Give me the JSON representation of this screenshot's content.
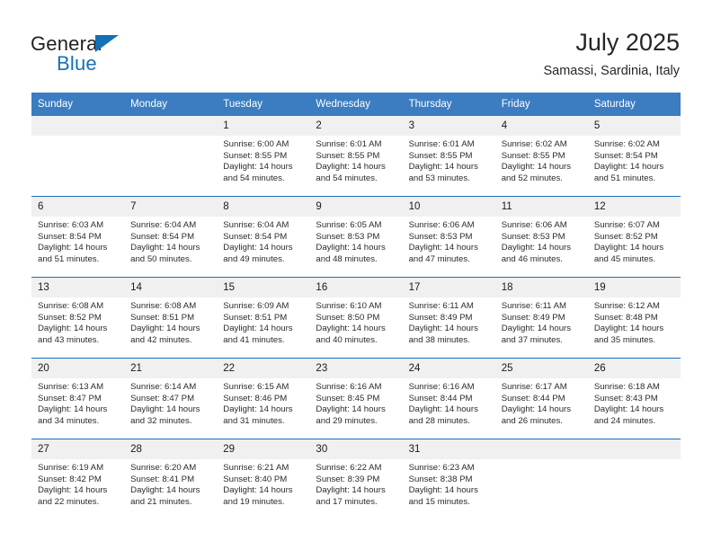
{
  "brand": {
    "name_top": "General",
    "name_bottom": "Blue",
    "triangle_color": "#1470b8"
  },
  "header": {
    "title": "July 2025",
    "subtitle": "Samassi, Sardinia, Italy"
  },
  "theme": {
    "header_bg": "#3b7dc0",
    "header_text": "#ffffff",
    "row_divider": "#1f6eb4",
    "daynum_bg": "#f0f0f0",
    "body_text": "#2b2b2b"
  },
  "weekday_headers": [
    "Sunday",
    "Monday",
    "Tuesday",
    "Wednesday",
    "Thursday",
    "Friday",
    "Saturday"
  ],
  "labels": {
    "sunrise": "Sunrise:",
    "sunset": "Sunset:",
    "daylight": "Daylight:"
  },
  "weeks": [
    [
      {
        "day": "",
        "empty": true
      },
      {
        "day": "",
        "empty": true
      },
      {
        "day": "1",
        "sunrise": "Sunrise: 6:00 AM",
        "sunset": "Sunset: 8:55 PM",
        "daylight_1": "Daylight: 14 hours",
        "daylight_2": "and 54 minutes."
      },
      {
        "day": "2",
        "sunrise": "Sunrise: 6:01 AM",
        "sunset": "Sunset: 8:55 PM",
        "daylight_1": "Daylight: 14 hours",
        "daylight_2": "and 54 minutes."
      },
      {
        "day": "3",
        "sunrise": "Sunrise: 6:01 AM",
        "sunset": "Sunset: 8:55 PM",
        "daylight_1": "Daylight: 14 hours",
        "daylight_2": "and 53 minutes."
      },
      {
        "day": "4",
        "sunrise": "Sunrise: 6:02 AM",
        "sunset": "Sunset: 8:55 PM",
        "daylight_1": "Daylight: 14 hours",
        "daylight_2": "and 52 minutes."
      },
      {
        "day": "5",
        "sunrise": "Sunrise: 6:02 AM",
        "sunset": "Sunset: 8:54 PM",
        "daylight_1": "Daylight: 14 hours",
        "daylight_2": "and 51 minutes."
      }
    ],
    [
      {
        "day": "6",
        "sunrise": "Sunrise: 6:03 AM",
        "sunset": "Sunset: 8:54 PM",
        "daylight_1": "Daylight: 14 hours",
        "daylight_2": "and 51 minutes."
      },
      {
        "day": "7",
        "sunrise": "Sunrise: 6:04 AM",
        "sunset": "Sunset: 8:54 PM",
        "daylight_1": "Daylight: 14 hours",
        "daylight_2": "and 50 minutes."
      },
      {
        "day": "8",
        "sunrise": "Sunrise: 6:04 AM",
        "sunset": "Sunset: 8:54 PM",
        "daylight_1": "Daylight: 14 hours",
        "daylight_2": "and 49 minutes."
      },
      {
        "day": "9",
        "sunrise": "Sunrise: 6:05 AM",
        "sunset": "Sunset: 8:53 PM",
        "daylight_1": "Daylight: 14 hours",
        "daylight_2": "and 48 minutes."
      },
      {
        "day": "10",
        "sunrise": "Sunrise: 6:06 AM",
        "sunset": "Sunset: 8:53 PM",
        "daylight_1": "Daylight: 14 hours",
        "daylight_2": "and 47 minutes."
      },
      {
        "day": "11",
        "sunrise": "Sunrise: 6:06 AM",
        "sunset": "Sunset: 8:53 PM",
        "daylight_1": "Daylight: 14 hours",
        "daylight_2": "and 46 minutes."
      },
      {
        "day": "12",
        "sunrise": "Sunrise: 6:07 AM",
        "sunset": "Sunset: 8:52 PM",
        "daylight_1": "Daylight: 14 hours",
        "daylight_2": "and 45 minutes."
      }
    ],
    [
      {
        "day": "13",
        "sunrise": "Sunrise: 6:08 AM",
        "sunset": "Sunset: 8:52 PM",
        "daylight_1": "Daylight: 14 hours",
        "daylight_2": "and 43 minutes."
      },
      {
        "day": "14",
        "sunrise": "Sunrise: 6:08 AM",
        "sunset": "Sunset: 8:51 PM",
        "daylight_1": "Daylight: 14 hours",
        "daylight_2": "and 42 minutes."
      },
      {
        "day": "15",
        "sunrise": "Sunrise: 6:09 AM",
        "sunset": "Sunset: 8:51 PM",
        "daylight_1": "Daylight: 14 hours",
        "daylight_2": "and 41 minutes."
      },
      {
        "day": "16",
        "sunrise": "Sunrise: 6:10 AM",
        "sunset": "Sunset: 8:50 PM",
        "daylight_1": "Daylight: 14 hours",
        "daylight_2": "and 40 minutes."
      },
      {
        "day": "17",
        "sunrise": "Sunrise: 6:11 AM",
        "sunset": "Sunset: 8:49 PM",
        "daylight_1": "Daylight: 14 hours",
        "daylight_2": "and 38 minutes."
      },
      {
        "day": "18",
        "sunrise": "Sunrise: 6:11 AM",
        "sunset": "Sunset: 8:49 PM",
        "daylight_1": "Daylight: 14 hours",
        "daylight_2": "and 37 minutes."
      },
      {
        "day": "19",
        "sunrise": "Sunrise: 6:12 AM",
        "sunset": "Sunset: 8:48 PM",
        "daylight_1": "Daylight: 14 hours",
        "daylight_2": "and 35 minutes."
      }
    ],
    [
      {
        "day": "20",
        "sunrise": "Sunrise: 6:13 AM",
        "sunset": "Sunset: 8:47 PM",
        "daylight_1": "Daylight: 14 hours",
        "daylight_2": "and 34 minutes."
      },
      {
        "day": "21",
        "sunrise": "Sunrise: 6:14 AM",
        "sunset": "Sunset: 8:47 PM",
        "daylight_1": "Daylight: 14 hours",
        "daylight_2": "and 32 minutes."
      },
      {
        "day": "22",
        "sunrise": "Sunrise: 6:15 AM",
        "sunset": "Sunset: 8:46 PM",
        "daylight_1": "Daylight: 14 hours",
        "daylight_2": "and 31 minutes."
      },
      {
        "day": "23",
        "sunrise": "Sunrise: 6:16 AM",
        "sunset": "Sunset: 8:45 PM",
        "daylight_1": "Daylight: 14 hours",
        "daylight_2": "and 29 minutes."
      },
      {
        "day": "24",
        "sunrise": "Sunrise: 6:16 AM",
        "sunset": "Sunset: 8:44 PM",
        "daylight_1": "Daylight: 14 hours",
        "daylight_2": "and 28 minutes."
      },
      {
        "day": "25",
        "sunrise": "Sunrise: 6:17 AM",
        "sunset": "Sunset: 8:44 PM",
        "daylight_1": "Daylight: 14 hours",
        "daylight_2": "and 26 minutes."
      },
      {
        "day": "26",
        "sunrise": "Sunrise: 6:18 AM",
        "sunset": "Sunset: 8:43 PM",
        "daylight_1": "Daylight: 14 hours",
        "daylight_2": "and 24 minutes."
      }
    ],
    [
      {
        "day": "27",
        "sunrise": "Sunrise: 6:19 AM",
        "sunset": "Sunset: 8:42 PM",
        "daylight_1": "Daylight: 14 hours",
        "daylight_2": "and 22 minutes."
      },
      {
        "day": "28",
        "sunrise": "Sunrise: 6:20 AM",
        "sunset": "Sunset: 8:41 PM",
        "daylight_1": "Daylight: 14 hours",
        "daylight_2": "and 21 minutes."
      },
      {
        "day": "29",
        "sunrise": "Sunrise: 6:21 AM",
        "sunset": "Sunset: 8:40 PM",
        "daylight_1": "Daylight: 14 hours",
        "daylight_2": "and 19 minutes."
      },
      {
        "day": "30",
        "sunrise": "Sunrise: 6:22 AM",
        "sunset": "Sunset: 8:39 PM",
        "daylight_1": "Daylight: 14 hours",
        "daylight_2": "and 17 minutes."
      },
      {
        "day": "31",
        "sunrise": "Sunrise: 6:23 AM",
        "sunset": "Sunset: 8:38 PM",
        "daylight_1": "Daylight: 14 hours",
        "daylight_2": "and 15 minutes."
      },
      {
        "day": "",
        "empty": true
      },
      {
        "day": "",
        "empty": true
      }
    ]
  ]
}
